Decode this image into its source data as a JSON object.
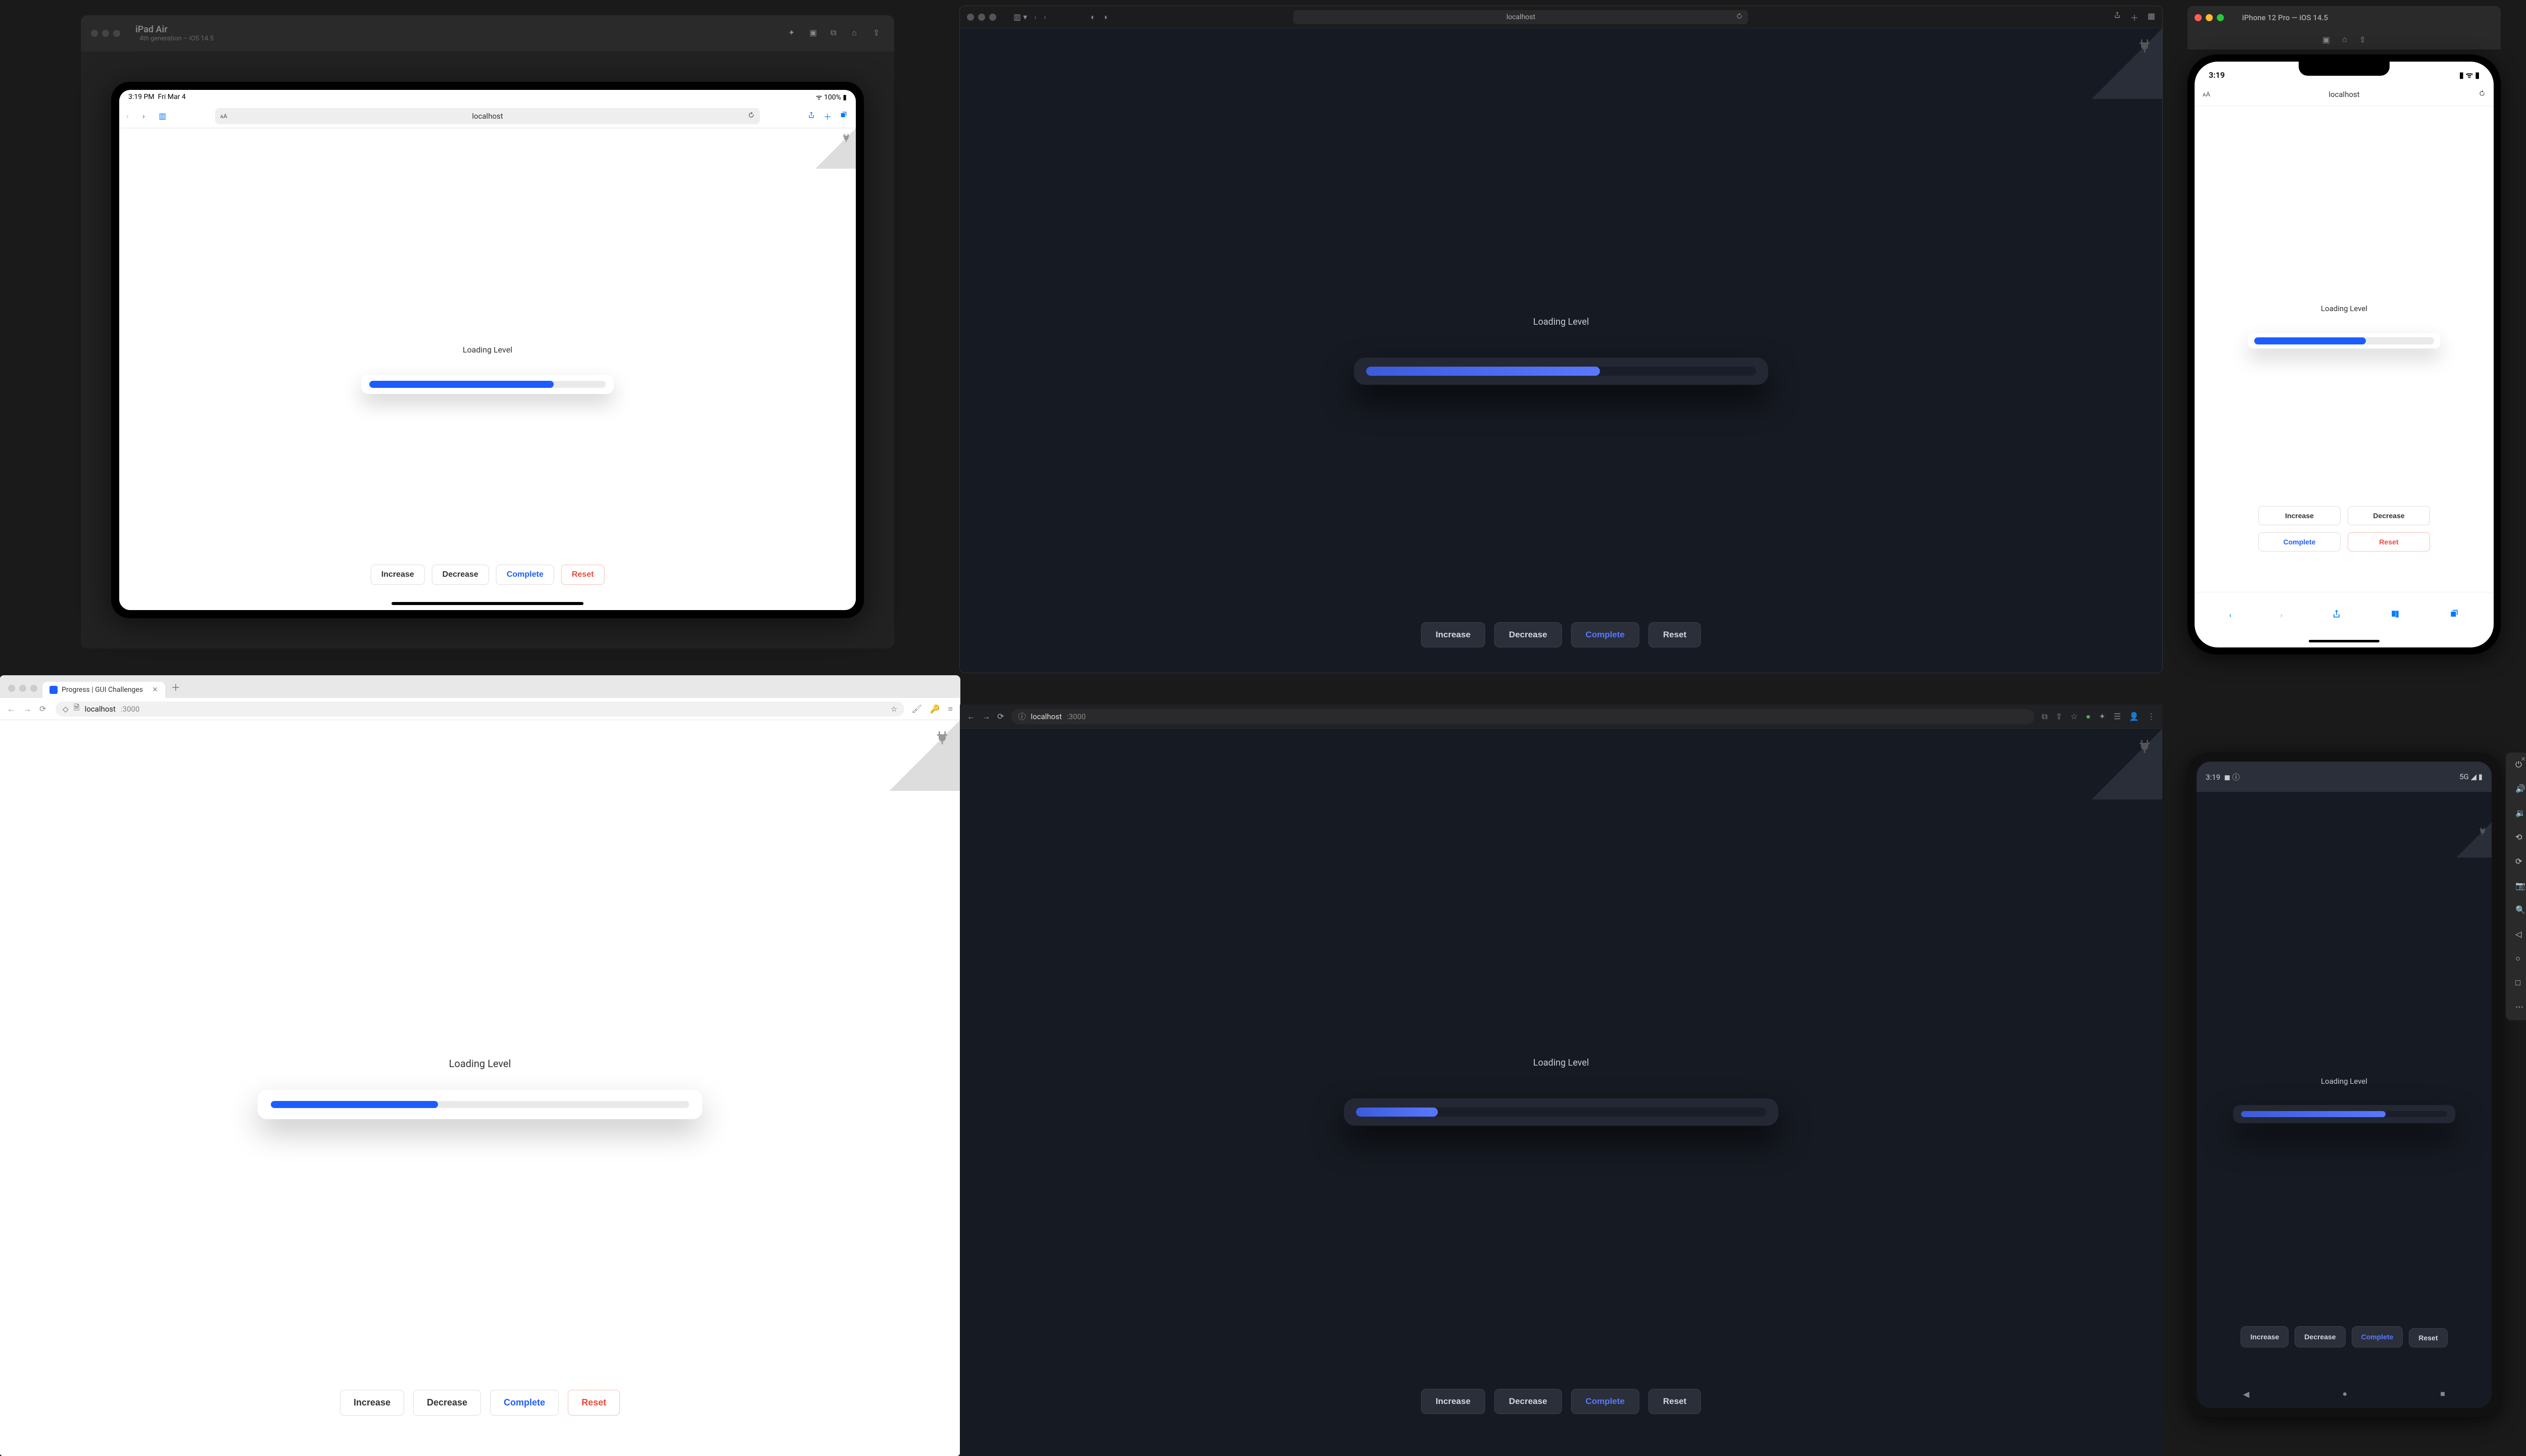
{
  "app": {
    "heading": "Loading Level",
    "buttons": {
      "increase": "Increase",
      "decrease": "Decrease",
      "complete": "Complete",
      "reset": "Reset"
    },
    "host": "localhost",
    "port": ":3000"
  },
  "progress": {
    "ipad_pct": 78,
    "safari_pct": 60,
    "iphone_pct": 62,
    "chrome_light_pct": 40,
    "chrome_dark_pct": 20,
    "android_pct": 70
  },
  "ipad": {
    "window_title": "iPad Air",
    "window_subtitle": "4th generation – iOS 14.5",
    "time": "3:19 PM",
    "date": "Fri Mar 4",
    "battery": "100%",
    "wifi_icon": "wifi-icon"
  },
  "safari": {
    "host": "localhost"
  },
  "iphone": {
    "window_title": "iPhone 12 Pro — iOS 14.5",
    "time": "3:19"
  },
  "chrome_light": {
    "tab_title": "Progress | GUI Challenges",
    "host": "localhost",
    "port": ":3000"
  },
  "chrome_dark": {
    "host": "localhost",
    "port": ":3000"
  },
  "android": {
    "time": "3:19",
    "status_icons": "5G ◢ ▮"
  },
  "icons": {
    "plug": "plug-icon"
  }
}
